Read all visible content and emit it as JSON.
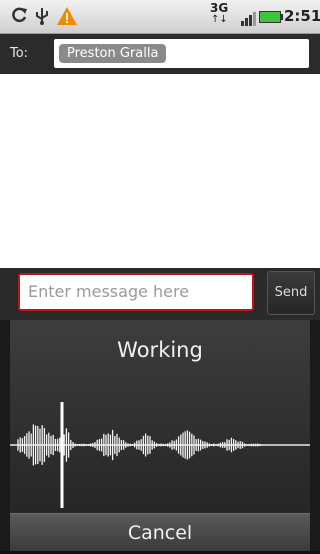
{
  "status_bar": {
    "network": "3G",
    "network_arrows": "↑↓",
    "time": "2:51",
    "icons": [
      "sync-icon",
      "usb-icon",
      "warning-icon",
      "signal-icon",
      "battery-icon"
    ],
    "warning_color": "#f08a00",
    "battery_color": "#3cc43c"
  },
  "recipient": {
    "to_label": "To:",
    "chip": "Preston Gralla"
  },
  "compose": {
    "placeholder": "Enter message here",
    "send_label": "Send"
  },
  "voice": {
    "status": "Working",
    "cancel_label": "Cancel"
  }
}
